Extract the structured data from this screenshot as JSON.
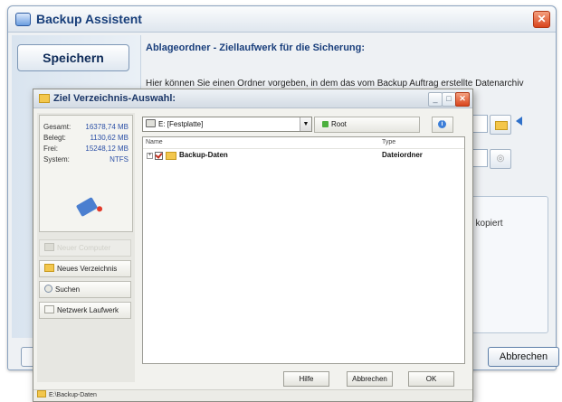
{
  "main_window": {
    "title": "Backup Assistent",
    "close_label": "✕",
    "left_button": "Speichern",
    "heading": "Ablageordner - Ziellaufwerk für die Sicherung:",
    "description": "Hier können Sie einen Ordner vorgeben, in dem das vom Backup Auftrag erstellte Datenarchiv",
    "status_fragment": "/ kopiert",
    "cancel_button": "Abbrechen"
  },
  "dialog": {
    "title": "Ziel Verzeichnis-Auswahl:",
    "window_buttons": {
      "minimize": "_",
      "maximize": "□",
      "close": "✕"
    },
    "info": {
      "rows": [
        {
          "label": "Gesamt:",
          "value": "16378,74 MB"
        },
        {
          "label": "Belegt:",
          "value": "1130,62 MB"
        },
        {
          "label": "Frei:",
          "value": "15248,12 MB"
        },
        {
          "label": "System:",
          "value": "NTFS"
        }
      ]
    },
    "side_buttons": [
      {
        "label": "Neuer Computer",
        "enabled": false
      },
      {
        "label": "Neues Verzeichnis",
        "enabled": true
      },
      {
        "label": "Suchen",
        "enabled": true
      },
      {
        "label": "Netzwerk Laufwerk",
        "enabled": true
      }
    ],
    "drive_select": {
      "value": "E: [Festplatte]",
      "dropdown_glyph": "▼"
    },
    "root_button": "Root",
    "help_glyph": "i",
    "tree": {
      "columns": [
        "Name",
        "Type"
      ],
      "rows": [
        {
          "expander": "+",
          "checked": true,
          "name": "Backup-Daten",
          "type": "Dateiordner"
        }
      ]
    },
    "buttons": {
      "help": "Hilfe",
      "cancel": "Abbrechen",
      "ok": "OK"
    },
    "status_path": "E:\\Backup-Daten"
  }
}
